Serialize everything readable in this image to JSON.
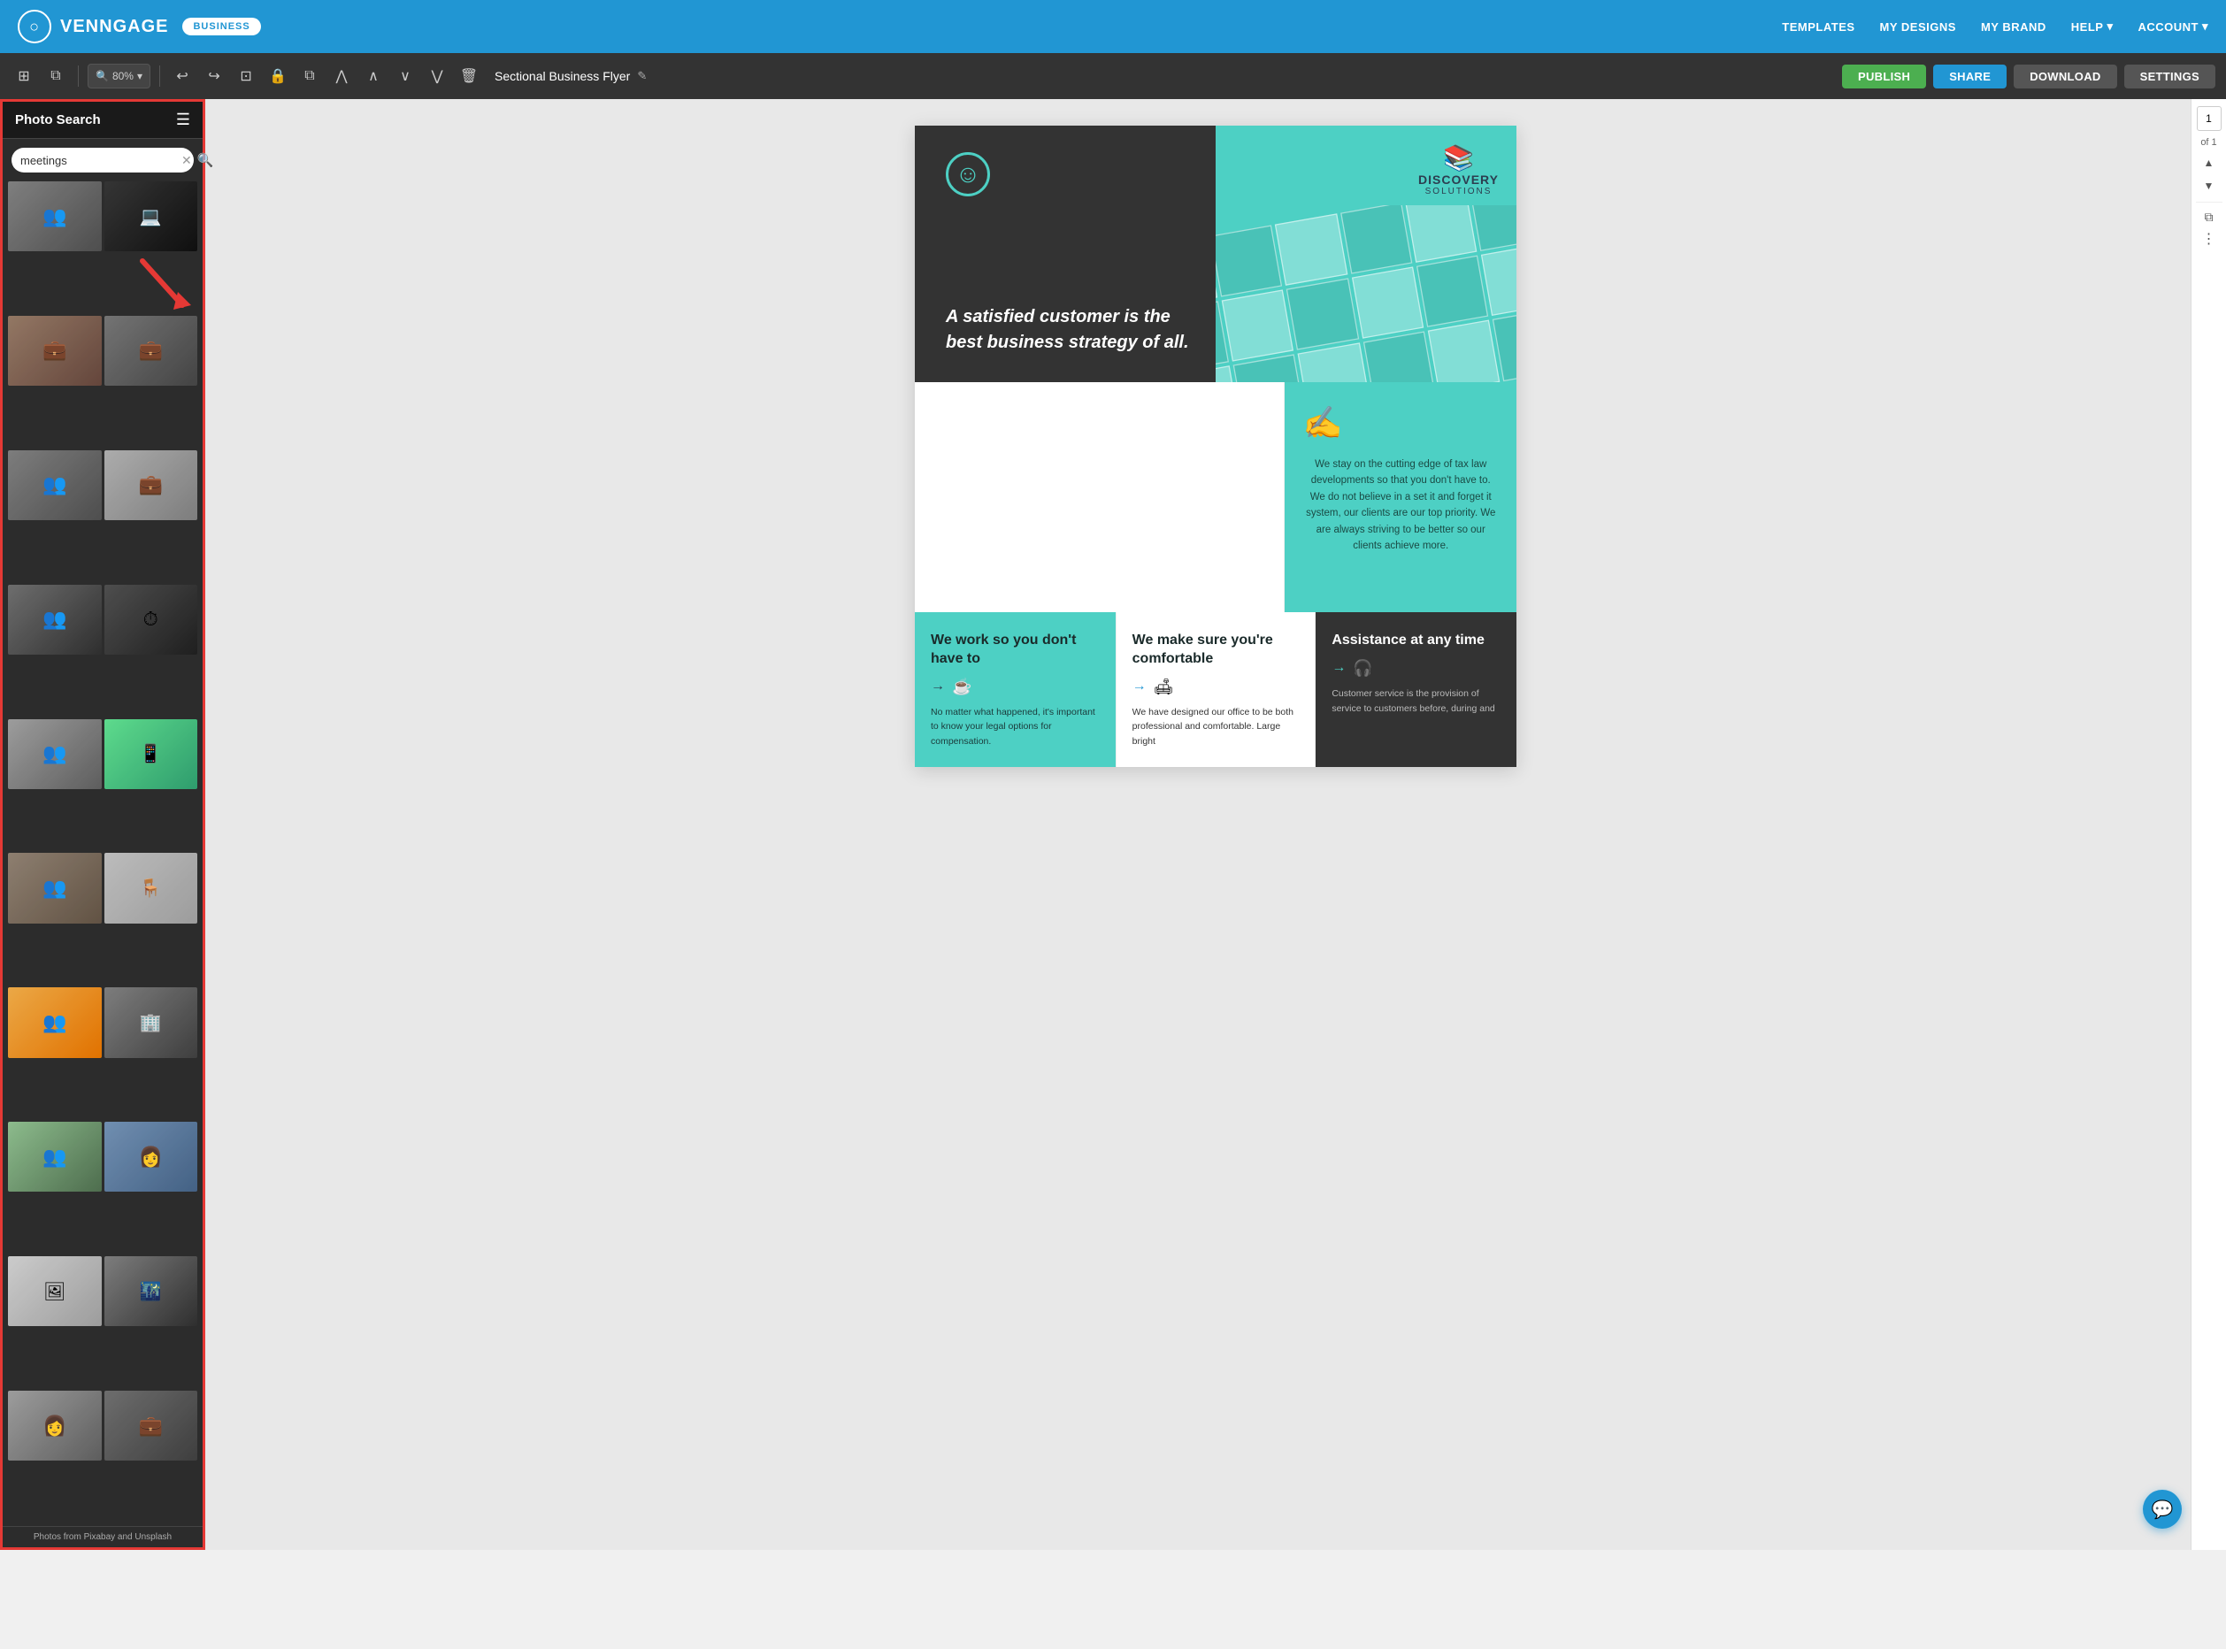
{
  "app": {
    "name": "VENNGAGE",
    "badge": "BUSINESS"
  },
  "nav": {
    "links": [
      "TEMPLATES",
      "MY DESIGNS",
      "MY BRAND"
    ],
    "help": "HELP",
    "account": "ACCOUNT"
  },
  "toolbar": {
    "zoom_label": "80%",
    "document_title": "Sectional Business Flyer",
    "buttons": {
      "publish": "PUBLISH",
      "share": "SHARE",
      "download": "DOWNLOAD",
      "settings": "SETTINGS"
    }
  },
  "sidebar": {
    "title": "Photo Search",
    "search_value": "meetings",
    "photos_credit": "Photos from Pixabay and Unsplash",
    "photos": [
      {
        "id": 1,
        "class": "p1 photo-people",
        "alt": "Meeting group"
      },
      {
        "id": 2,
        "class": "p2 photo-laptop",
        "alt": "Laptop meeting dark"
      },
      {
        "id": 3,
        "class": "p3 photo-meeting",
        "alt": "Business meeting"
      },
      {
        "id": 4,
        "class": "p4 photo-meeting",
        "alt": "Team standing meeting"
      },
      {
        "id": 5,
        "class": "p5 photo-people",
        "alt": "Business people"
      },
      {
        "id": 6,
        "class": "p6 photo-meeting",
        "alt": "Office coffee"
      },
      {
        "id": 7,
        "class": "p7 photo-people",
        "alt": "Business discussion"
      },
      {
        "id": 8,
        "class": "p8 photo-clock",
        "alt": "Stopwatch deadline"
      },
      {
        "id": 9,
        "class": "p9 photo-people",
        "alt": "Group meeting casual"
      },
      {
        "id": 10,
        "class": "p10 photo-phone",
        "alt": "Phone on table"
      },
      {
        "id": 11,
        "class": "p11 photo-people",
        "alt": "Office worker"
      },
      {
        "id": 12,
        "class": "p12 photo-table",
        "alt": "Conference table"
      },
      {
        "id": 13,
        "class": "p13 photo-people",
        "alt": "Woman office"
      },
      {
        "id": 14,
        "class": "p14 photo-room",
        "alt": "Meeting room"
      },
      {
        "id": 15,
        "class": "p15 photo-people",
        "alt": "Park meeting"
      },
      {
        "id": 16,
        "class": "p16 photo-woman",
        "alt": "Woman portrait"
      },
      {
        "id": 17,
        "class": "p17 photo-cartoon",
        "alt": "Cartoon meeting"
      },
      {
        "id": 18,
        "class": "p18 photo-night",
        "alt": "Night meeting"
      },
      {
        "id": 19,
        "class": "p19 photo-woman",
        "alt": "Woman at laptop"
      },
      {
        "id": 20,
        "class": "p20 photo-meeting",
        "alt": "Business meeting table"
      }
    ]
  },
  "page_controls": {
    "current_page": "1",
    "of_label": "of 1"
  },
  "flyer": {
    "smiley": "☺",
    "quote": "A satisfied customer is the best business strategy of all.",
    "company_name": "DISCOVERY",
    "company_sub": "SOLUTIONS",
    "middle_right_text": "We stay on the cutting edge of tax law developments so that you don't have to. We do not believe in a set it and forget it system, our clients are our top priority. We are always striving to be better so our clients achieve more.",
    "col1_heading": "We work so you don't have to",
    "col2_heading": "We make sure you're comfortable",
    "col3_heading": "Assistance at any time",
    "col1_body": "No matter what happened, it's important to know your legal options for compensation.",
    "col2_body": "We have designed our office to be both professional and comfortable. Large bright",
    "col3_body": "Customer service is the provision of service to customers before, during and"
  }
}
